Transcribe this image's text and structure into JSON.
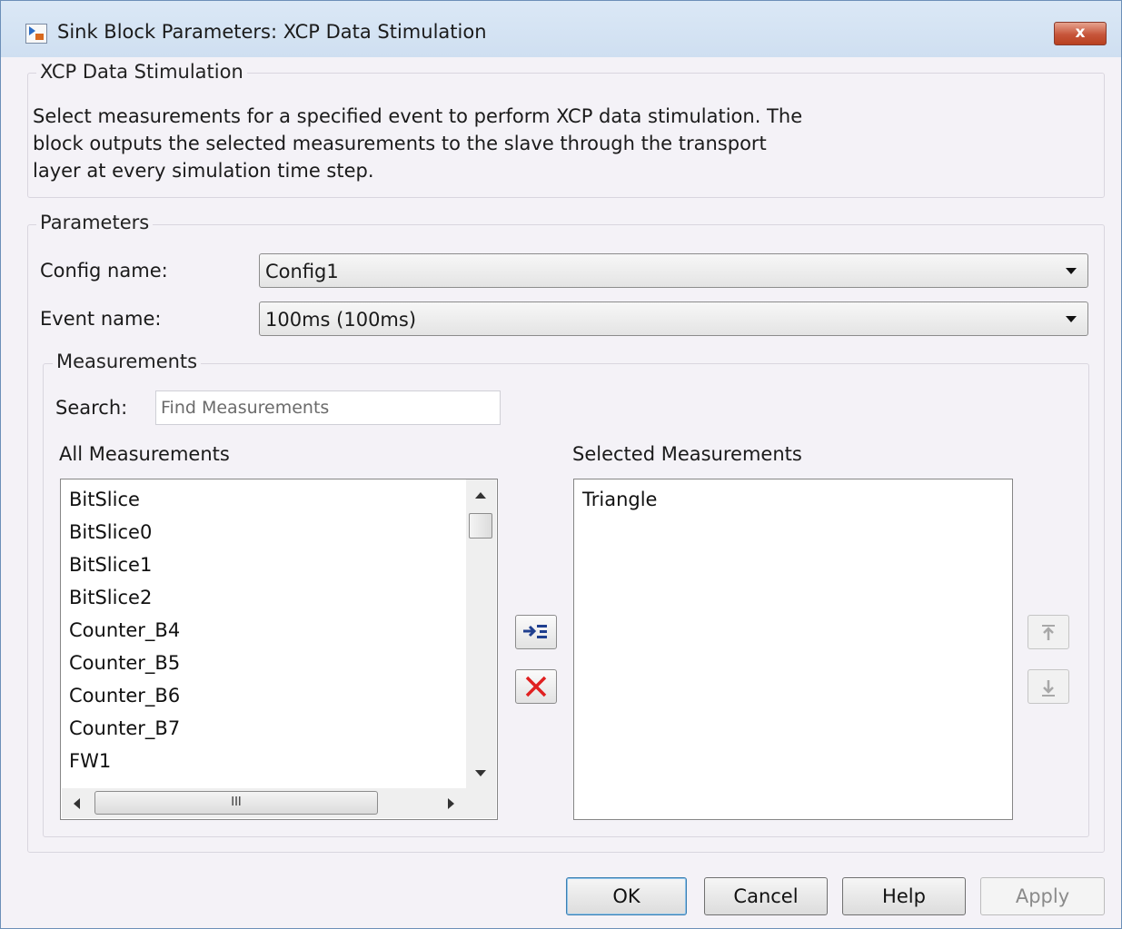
{
  "window": {
    "title": "Sink Block Parameters: XCP Data Stimulation",
    "close_glyph": "x"
  },
  "description_group": {
    "legend": "XCP Data Stimulation",
    "lines": [
      "Select measurements for a specified event to perform XCP data stimulation. The",
      "block outputs the selected measurements to the slave through the transport",
      "layer at every simulation time step."
    ]
  },
  "parameters": {
    "legend": "Parameters",
    "config_label": "Config name:",
    "config_value": "Config1",
    "event_label": "Event name:",
    "event_value": "100ms (100ms)"
  },
  "measurements": {
    "legend": "Measurements",
    "search_label": "Search:",
    "search_placeholder": "Find Measurements",
    "all_title": "All Measurements",
    "selected_title": "Selected Measurements",
    "all_items": [
      "BitSlice",
      "BitSlice0",
      "BitSlice1",
      "BitSlice2",
      "Counter_B4",
      "Counter_B5",
      "Counter_B6",
      "Counter_B7",
      "FW1"
    ],
    "selected_items": [
      "Triangle"
    ],
    "hscroll_grip": "III"
  },
  "icons": {
    "add": "add-to-list-icon",
    "remove": "remove-icon",
    "move_up": "move-up-icon",
    "move_down": "move-down-icon"
  },
  "buttons": {
    "ok": "OK",
    "cancel": "Cancel",
    "help": "Help",
    "apply": "Apply"
  },
  "colors": {
    "remove_icon": "#e02020",
    "add_icon": "#1f3f8f",
    "close_button": "#c7553a"
  }
}
